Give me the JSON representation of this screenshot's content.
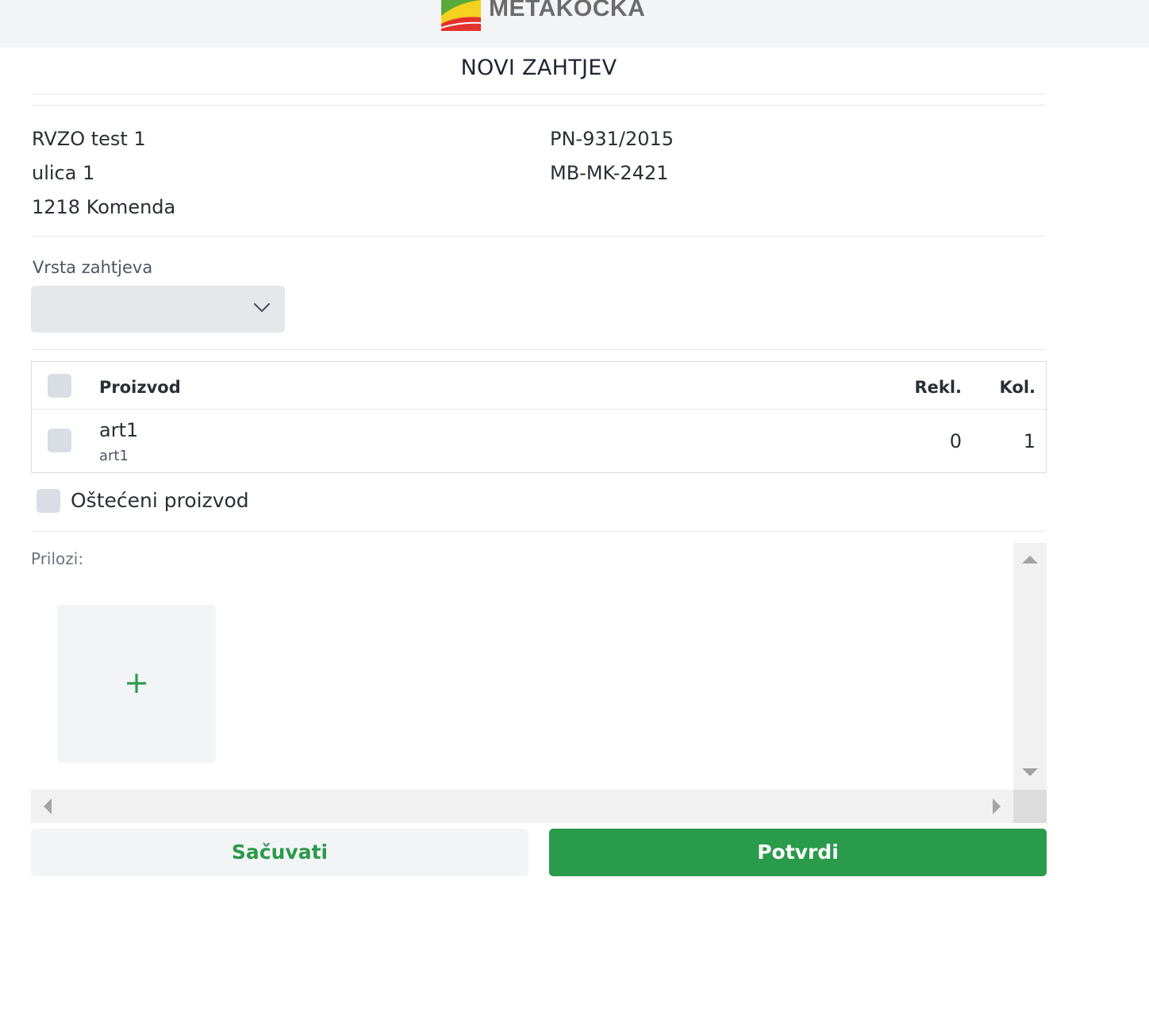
{
  "header": {
    "brand_name": "METAKOCKA",
    "logo_icon": "metakocka-logo",
    "brand_colors": {
      "green": "#5aa83a",
      "yellow": "#f4d21f",
      "red": "#e4322b"
    }
  },
  "page": {
    "title": "NOVI ZAHTJEV"
  },
  "customer": {
    "name": "RVZO test 1",
    "street": "ulica 1",
    "city": "1218 Komenda"
  },
  "document": {
    "number": "PN-931/2015",
    "code": "MB-MK-2421"
  },
  "request_type": {
    "label": "Vrsta zahtjeva",
    "selected": ""
  },
  "products_table": {
    "columns": {
      "product": "Proizvod",
      "claimed": "Rekl.",
      "quantity": "Kol."
    },
    "rows": [
      {
        "name": "art1",
        "code": "art1",
        "claimed": "0",
        "quantity": "1",
        "checked": false
      }
    ]
  },
  "damaged": {
    "label": "Oštećeni proizvod",
    "checked": false
  },
  "attachments": {
    "label": "Prilozi:",
    "add_symbol": "+"
  },
  "actions": {
    "save_label": "Sačuvati",
    "confirm_label": "Potvrdi"
  },
  "colors": {
    "accent": "#2a9a4b",
    "muted_bg": "#f3f4f6",
    "checkbox": "#d9dee4"
  }
}
